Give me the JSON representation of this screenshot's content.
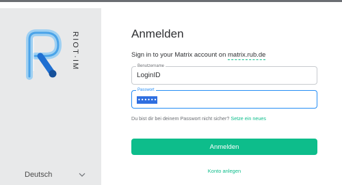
{
  "brand": {
    "name": "RIOT·IM",
    "logo_icon": "riot-logo-icon",
    "accent_color": "#0dbd8b"
  },
  "sidebar": {
    "language": "Deutsch",
    "language_icon": "chevron-down-icon"
  },
  "login": {
    "title": "Anmelden",
    "subtitle_prefix": "Sign in to your Matrix account on",
    "server": "matrix.rub.de",
    "username": {
      "label": "Benutzername",
      "value": "LoginID"
    },
    "password": {
      "label": "Passwort",
      "value": "••••••"
    },
    "forgot_text": "Du bist dir bei deinem Passwort nicht sicher?",
    "forgot_link": "Setze ein neues",
    "submit_label": "Anmelden",
    "create_account_label": "Konto anlegen"
  }
}
